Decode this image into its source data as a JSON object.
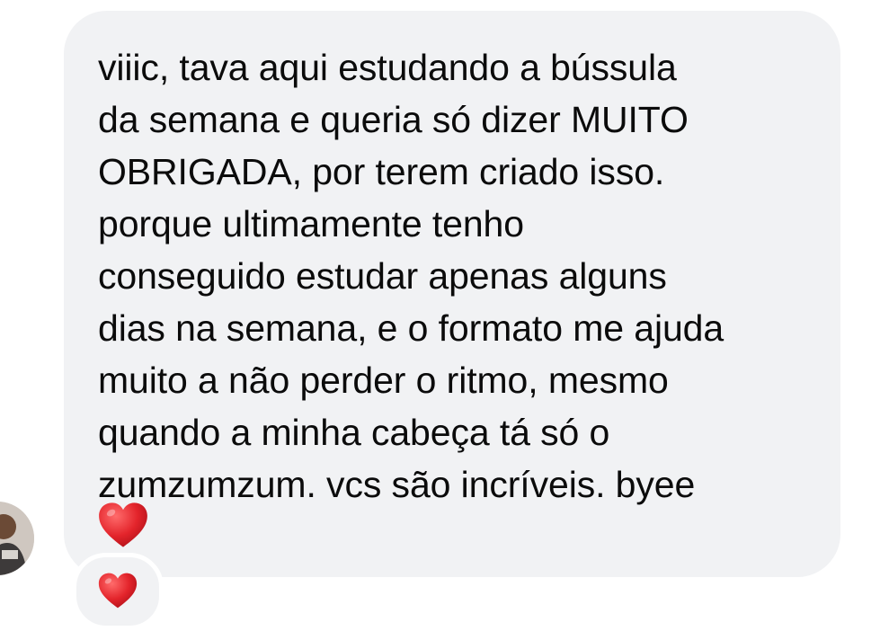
{
  "message": {
    "text": "viiic, tava aqui estudando a bússula\nda semana e queria só dizer MUITO\nOBRIGADA, por terem criado isso.\nporque ultimamente tenho\nconseguido estudar apenas alguns\ndias na semana, e o formato me ajuda\nmuito a não perder o ritmo, mesmo\nquando a minha cabeça tá só o\nzumzumzum. vcs são incríveis. byee",
    "emoji_icon": "red-heart-icon"
  },
  "reaction": {
    "emoji_icon": "red-heart-icon"
  },
  "colors": {
    "bubble_bg": "#f1f2f4",
    "text": "#0b0b0b",
    "heart": "#e3242b"
  }
}
